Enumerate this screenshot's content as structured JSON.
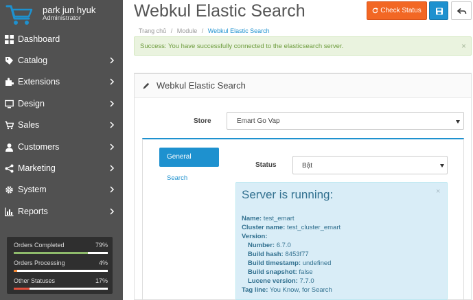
{
  "profile": {
    "name": "park jun hyuk",
    "role": "Administrator"
  },
  "nav": [
    {
      "label": "Dashboard",
      "icon": "dashboard-icon"
    },
    {
      "label": "Catalog",
      "icon": "tag-icon"
    },
    {
      "label": "Extensions",
      "icon": "puzzle-icon"
    },
    {
      "label": "Design",
      "icon": "monitor-icon"
    },
    {
      "label": "Sales",
      "icon": "cart-icon"
    },
    {
      "label": "Customers",
      "icon": "user-icon"
    },
    {
      "label": "Marketing",
      "icon": "share-icon"
    },
    {
      "label": "System",
      "icon": "gear-icon"
    },
    {
      "label": "Reports",
      "icon": "bar-chart-icon"
    }
  ],
  "stats": [
    {
      "label": "Orders Completed",
      "value": "79%",
      "fraction": 0.79,
      "color": "#8fbb6c"
    },
    {
      "label": "Orders Processing",
      "value": "4%",
      "fraction": 0.04,
      "color": "#f38733"
    },
    {
      "label": "Other Statuses",
      "value": "17%",
      "fraction": 0.17,
      "color": "#e3503e"
    }
  ],
  "header": {
    "title": "Webkul Elastic Search",
    "check_status_label": "Check Status"
  },
  "breadcrumb": [
    "Trang chủ",
    "Module",
    "Webkul Elastic Search"
  ],
  "alert": {
    "text": "Success: You have successfully connected to the elasticsearch server.",
    "close": "×"
  },
  "panel": {
    "title": "Webkul Elastic Search",
    "store_label": "Store",
    "store_value": "Emart Go Vap",
    "tabs": [
      "General",
      "Search"
    ],
    "status_label": "Status",
    "status_value": "Bật"
  },
  "info": {
    "title": "Server is running:",
    "close": "×",
    "name_label": "Name:",
    "name_value": "test_emart",
    "cluster_label": "Cluster name:",
    "cluster_value": "test_cluster_emart",
    "version_label": "Version:",
    "number_label": "Number:",
    "number_value": "6.7.0",
    "hash_label": "Build hash:",
    "hash_value": "8453f77",
    "timestamp_label": "Build timestamp:",
    "timestamp_value": "undefined",
    "snapshot_label": "Build snapshot:",
    "snapshot_value": "false",
    "lucene_label": "Lucene version:",
    "lucene_value": "7.7.0",
    "tagline_label": "Tag line:",
    "tagline_value": "You Know, for Search"
  },
  "colors": {
    "sidebar": "#515151",
    "accent": "#1e91cf",
    "warning": "#f26724",
    "success_bg": "#eaf3df",
    "info_bg": "#d9edf7"
  }
}
